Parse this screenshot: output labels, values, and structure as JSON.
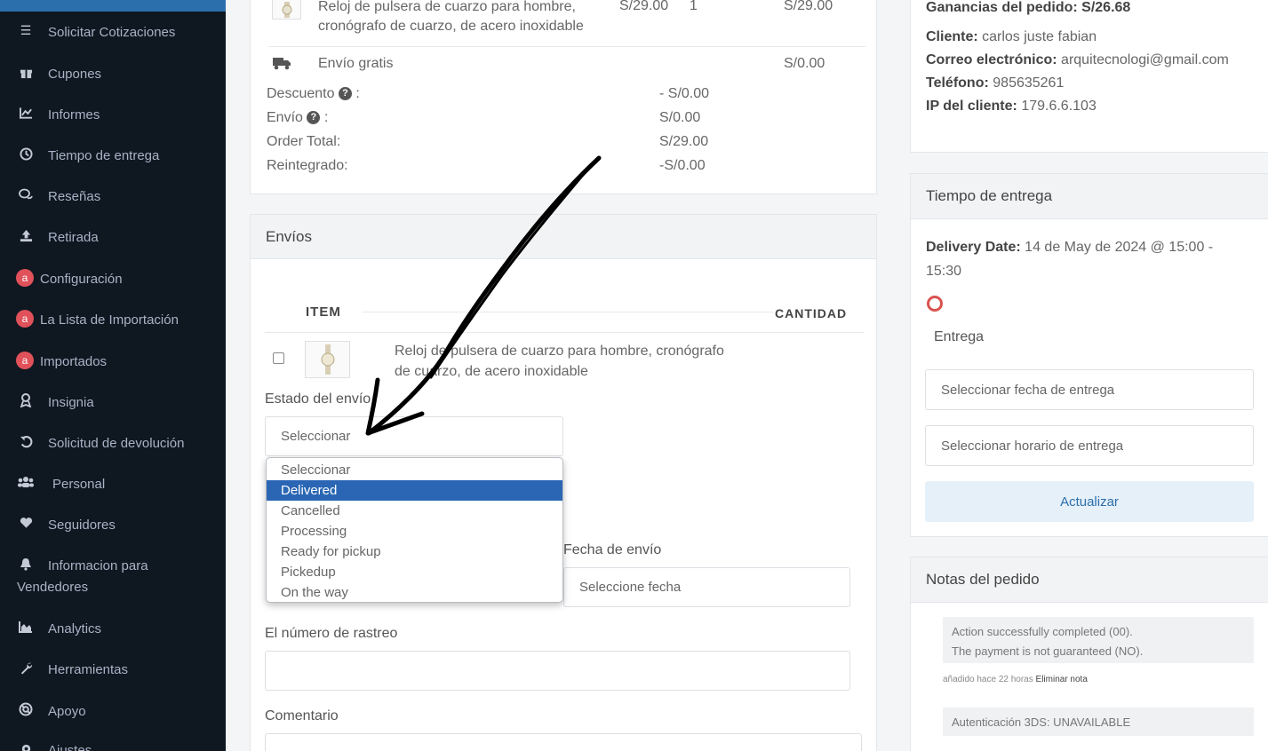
{
  "sidebar": {
    "items": [
      {
        "label": "Solicitar Cotizaciones",
        "icon": "list-icon"
      },
      {
        "label": "Cupones",
        "icon": "gift-icon"
      },
      {
        "label": "Informes",
        "icon": "chart-icon"
      },
      {
        "label": "Tiempo de entrega",
        "icon": "clock-icon"
      },
      {
        "label": "Reseñas",
        "icon": "comments-icon"
      },
      {
        "label": "Retirada",
        "icon": "upload-icon"
      },
      {
        "label": "Configuración",
        "icon": "a-badge-icon"
      },
      {
        "label": "La Lista de Importación",
        "icon": "a-badge-icon"
      },
      {
        "label": "Importados",
        "icon": "a-badge-icon"
      },
      {
        "label": "Insignia",
        "icon": "award-icon"
      },
      {
        "label": "Solicitud de devolución",
        "icon": "undo-icon"
      },
      {
        "label": "Personal",
        "icon": "users-icon"
      },
      {
        "label": "Seguidores",
        "icon": "heart-icon"
      },
      {
        "label": "Informacion para",
        "label2": "Vendedores",
        "icon": "bell-icon"
      },
      {
        "label": "Analytics",
        "icon": "area-chart-icon"
      },
      {
        "label": "Herramientas",
        "icon": "wrench-icon"
      },
      {
        "label": "Apoyo",
        "icon": "support-icon"
      },
      {
        "label": "Ajustes",
        "icon": "gear-icon"
      }
    ],
    "badge_letter": "a"
  },
  "order": {
    "product_line1": "Reloj de pulsera de cuarzo para hombre,",
    "product_line2": "cronógrafo de cuarzo, de acero inoxidable",
    "unit_price": "S/29.00",
    "qty": "1",
    "line_total": "S/29.00",
    "shipping_label": "Envío gratis",
    "shipping_value": "S/0.00",
    "discount_label": "Descuento",
    "discount_value": "- S/0.00",
    "envio_label": "Envío",
    "envio_value": "S/0.00",
    "total_label": "Order Total:",
    "total_value": "S/29.00",
    "refund_label": "Reintegrado:",
    "refund_value": "-S/0.00",
    "help_glyph": "?",
    "colon": ":"
  },
  "envios": {
    "title": "Envíos",
    "col_item": "ITEM",
    "col_qty": "CANTIDAD",
    "product_line1": "Reloj de pulsera de cuarzo para hombre, cronógrafo",
    "product_line2": "de cuarzo, de acero inoxidable",
    "status_label": "Estado del envío",
    "status_value": "Seleccionar",
    "status_options": [
      "Seleccionar",
      "Delivered",
      "Cancelled",
      "Processing",
      "Ready for pickup",
      "Pickedup",
      "On the way"
    ],
    "selected_option": "Delivered",
    "date_label": "Fecha de envío",
    "date_placeholder": "Seleccione fecha",
    "tracking_label": "El número de rastreo",
    "tracking_value": "",
    "comment_label": "Comentario",
    "comment_value": ""
  },
  "customer": {
    "earnings": "Ganancias del pedido: S/26.68",
    "client_label": "Cliente:",
    "client_value": "carlos juste fabian",
    "email_label": "Correo electrónico:",
    "email_value": "arquitecnologi@gmail.com",
    "phone_label": "Teléfono:",
    "phone_value": "985635261",
    "ip_label": "IP del cliente:",
    "ip_value": "179.6.6.103"
  },
  "delivery": {
    "title": "Tiempo de entrega",
    "date_label": "Delivery Date:",
    "date_value": "14 de May de 2024 @ 15:00 -",
    "date_value2": "15:30",
    "option_label": "Entrega",
    "date_placeholder": "Seleccionar fecha de entrega",
    "time_placeholder": "Seleccionar horario de entrega",
    "update_button": "Actualizar",
    "accent": "#d9534f"
  },
  "notes": {
    "title": "Notas del pedido",
    "items": [
      {
        "line1": "Action successfully completed (00).",
        "line2": "The payment is not guaranteed (NO).",
        "meta": "añadido hace 22 horas",
        "delete": "Eliminar nota"
      },
      {
        "line1": "Autenticación 3DS: UNAVAILABLE"
      }
    ]
  },
  "colors": {
    "sidebar_bg": "#0f1721",
    "accent_blue": "#2a66b4",
    "badge": "#e0515a"
  }
}
